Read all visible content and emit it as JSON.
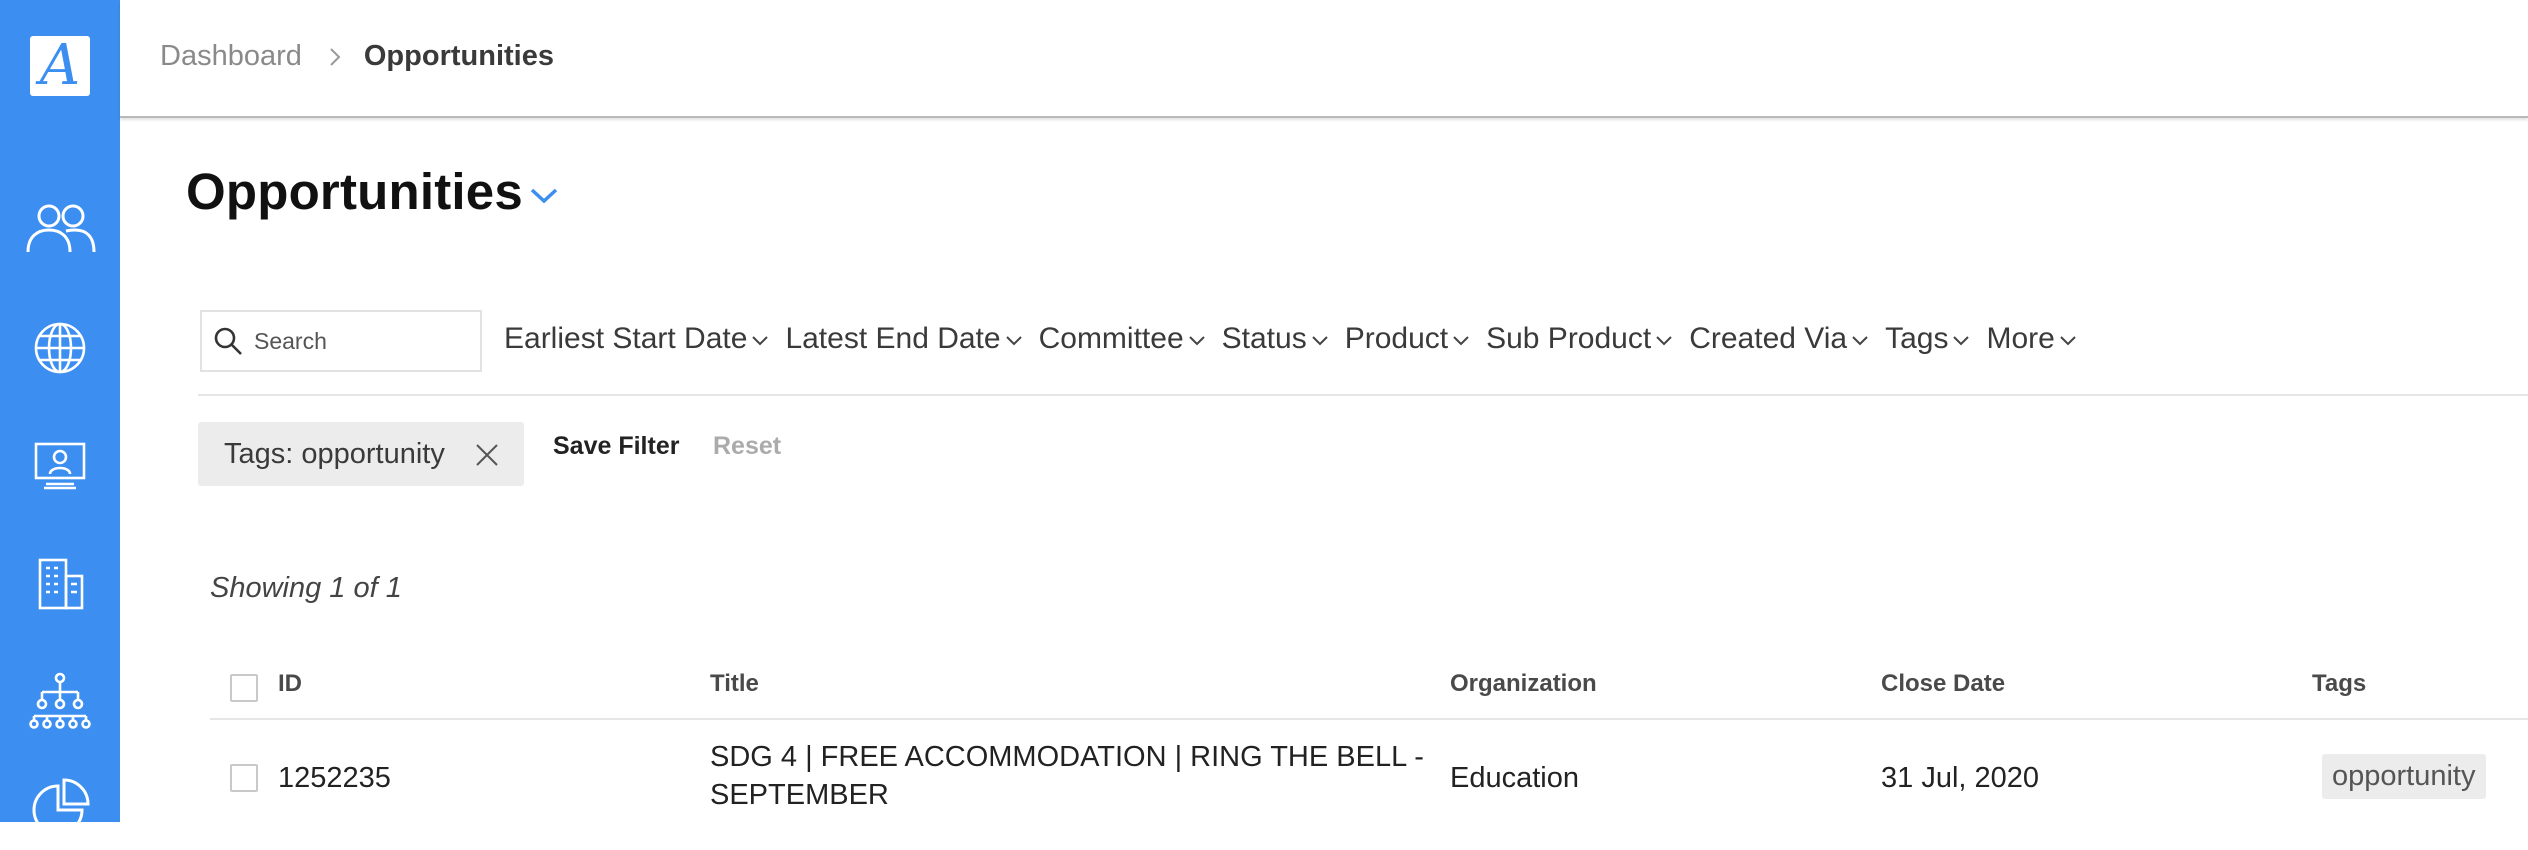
{
  "sidebar": {
    "logo_letter": "A",
    "items": [
      {
        "icon": "people-icon"
      },
      {
        "icon": "globe-icon"
      },
      {
        "icon": "presentation-icon"
      },
      {
        "icon": "building-icon"
      },
      {
        "icon": "hierarchy-icon"
      },
      {
        "icon": "pie-chart-icon"
      }
    ],
    "color": "#3c8ff0"
  },
  "breadcrumb": {
    "items": [
      "Dashboard"
    ],
    "current": "Opportunities"
  },
  "page": {
    "title": "Opportunities"
  },
  "search": {
    "placeholder": "Search",
    "value": ""
  },
  "filters": [
    "Earliest Start Date",
    "Latest End Date",
    "Committee",
    "Status",
    "Product",
    "Sub Product",
    "Created Via",
    "Tags",
    "More"
  ],
  "active_filter": {
    "label": "Tags: opportunity"
  },
  "actions": {
    "save_filter": "Save Filter",
    "reset": "Reset"
  },
  "results": {
    "showing": "Showing 1 of 1"
  },
  "table": {
    "columns": [
      "ID",
      "Title",
      "Organization",
      "Close Date",
      "Tags"
    ],
    "rows": [
      {
        "id": "1252235",
        "title_line1": "SDG 4 | FREE ACCOMMODATION | RING THE BELL -",
        "title_line2": "SEPTEMBER",
        "organization": "Education",
        "close_date": "31 Jul, 2020",
        "tag": "opportunity"
      }
    ]
  },
  "colors": {
    "accent": "#3c8ff0",
    "chip_bg": "#ececec"
  }
}
